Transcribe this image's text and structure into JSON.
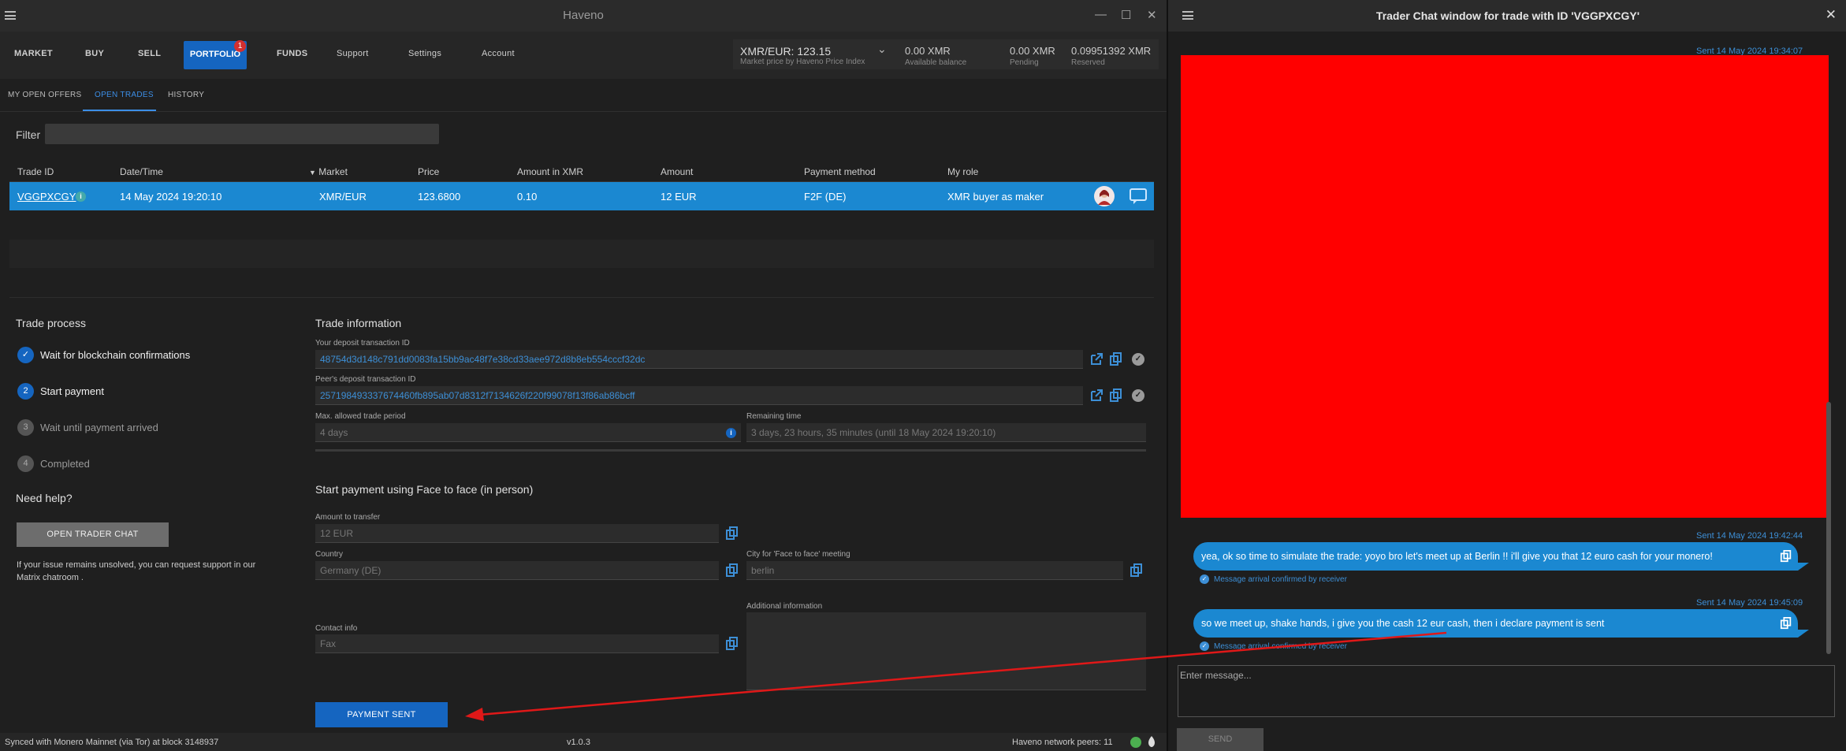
{
  "app": {
    "title": "Haveno",
    "minimize": "—",
    "maximize": "☐",
    "close": "✕"
  },
  "nav": {
    "market": "MARKET",
    "buy": "BUY",
    "sell": "SELL",
    "portfolio": "PORTFOLIO",
    "portfolio_badge": "1",
    "funds": "FUNDS",
    "support": "Support",
    "settings": "Settings",
    "account": "Account"
  },
  "price": {
    "pair": "XMR/EUR: 123.15",
    "pair_sub": "Market price by Haveno Price Index",
    "available": "0.00 XMR",
    "available_label": "Available balance",
    "pending": "0.00 XMR",
    "pending_label": "Pending",
    "reserved": "0.09951392 XMR",
    "reserved_label": "Reserved"
  },
  "subtabs": {
    "open_offers": "MY OPEN OFFERS",
    "open_trades": "OPEN TRADES",
    "history": "HISTORY"
  },
  "filter": {
    "label": "Filter",
    "value": ""
  },
  "table": {
    "headers": {
      "trade_id": "Trade ID",
      "date": "Date/Time",
      "market": "Market",
      "price": "Price",
      "amount_xmr": "Amount in XMR",
      "amount": "Amount",
      "payment": "Payment method",
      "role": "My role"
    },
    "row": {
      "trade_id": "VGGPXCGY",
      "date": "14 May 2024 19:20:10",
      "market": "XMR/EUR",
      "price": "123.6800",
      "amount_xmr": "0.10",
      "amount": "12 EUR",
      "payment": "F2F (DE)",
      "role": "XMR buyer as maker"
    }
  },
  "process": {
    "title": "Trade process",
    "steps": [
      {
        "num": "✓",
        "label": "Wait for blockchain confirmations"
      },
      {
        "num": "2",
        "label": "Start payment"
      },
      {
        "num": "3",
        "label": "Wait until payment arrived"
      },
      {
        "num": "4",
        "label": "Completed"
      }
    ],
    "help_title": "Need help?",
    "chat_button": "OPEN TRADER CHAT",
    "help_text": "If your issue remains unsolved, you can request support in our Matrix chatroom ."
  },
  "info": {
    "title": "Trade information",
    "deposit_label": "Your deposit transaction ID",
    "deposit_value": "48754d3d148c791dd0083fa15bb9ac48f7e38cd33aee972d8b8eb554cccf32dc",
    "peer_label": "Peer's deposit transaction ID",
    "peer_value": "257198493337674460fb895ab07d8312f7134626f220f99078f13f86ab86bcff",
    "period_label": "Max. allowed trade period",
    "period_value": "4 days",
    "remaining_label": "Remaining time",
    "remaining_value": "3 days, 23 hours, 35 minutes (until 18 May 2024 19:20:10)"
  },
  "payment": {
    "title": "Start payment using Face to face (in person)",
    "amount_label": "Amount to transfer",
    "amount_value": "12 EUR",
    "country_label": "Country",
    "country_value": "Germany (DE)",
    "city_label": "City for 'Face to face' meeting",
    "city_value": "berlin",
    "contact_label": "Contact info",
    "contact_value": "Fax",
    "additional_label": "Additional information",
    "sent_button": "PAYMENT SENT"
  },
  "status": {
    "sync": "Synced with Monero Mainnet (via Tor) at block 3148937",
    "version": "v1.0.3",
    "peers": "Haveno network peers: 11"
  },
  "chat": {
    "title": "Trader Chat window for trade with ID 'VGGPXCGY'",
    "close": "✕",
    "messages": [
      {
        "date": "Sent 14 May 2024 19:34:07"
      },
      {
        "date": "Sent 14 May 2024 19:42:44",
        "text": "yea, ok so time to simulate the trade: yoyo bro let's meet up at Berlin !! i'll give you that 12 euro cash for your monero!",
        "confirm": "Message arrival confirmed by receiver"
      },
      {
        "date": "Sent 14 May 2024 19:45:09",
        "text": "so we meet up, shake hands, i give you the cash 12 eur cash, then i declare payment is sent",
        "confirm": "Message arrival confirmed by receiver"
      }
    ],
    "input_placeholder": "Enter message...",
    "send": "SEND"
  },
  "colors": {
    "accent": "#1565c0",
    "row": "#1b88d1",
    "link": "#3d8fd6",
    "arrow": "#e01818",
    "redacted": "#ff0000"
  }
}
